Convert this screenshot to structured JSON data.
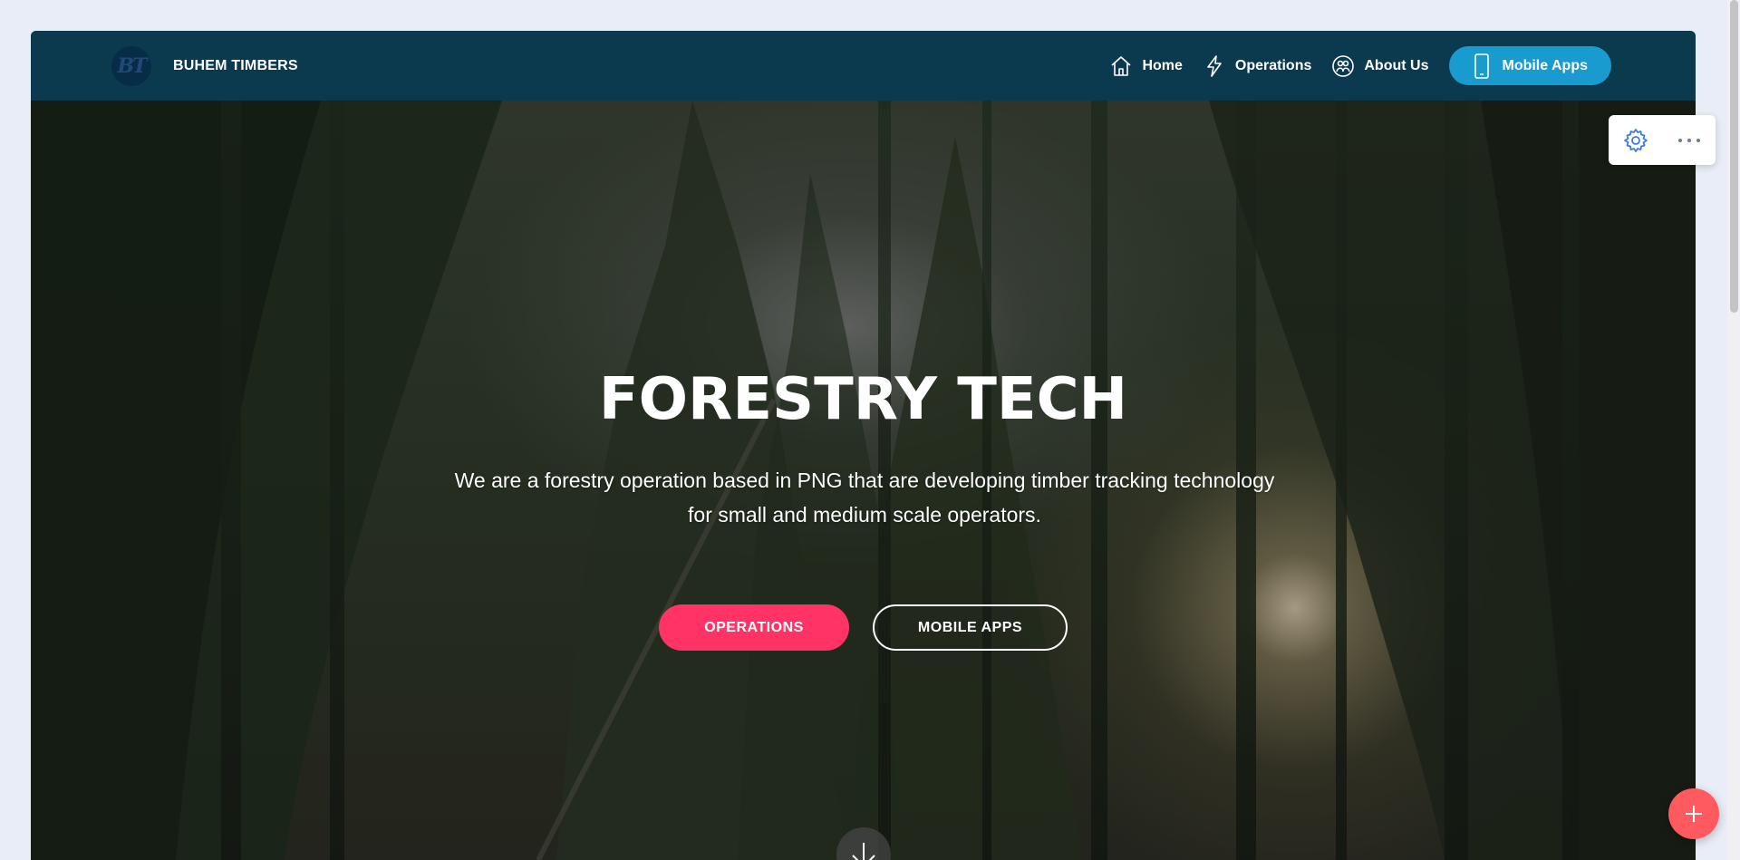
{
  "navbar": {
    "logo_text": "BT",
    "brand": "BUHEM TIMBERS",
    "links": [
      {
        "label": "Home",
        "icon": "home-icon"
      },
      {
        "label": "Operations",
        "icon": "lightning-icon"
      },
      {
        "label": "About Us",
        "icon": "people-circle-icon"
      }
    ],
    "cta": {
      "label": "Mobile Apps",
      "icon": "mobile-phone-icon"
    }
  },
  "hero": {
    "title": "FORESTRY TECH",
    "text": "We are a forestry operation based in PNG that are developing timber tracking technology for small and medium scale operators.",
    "buttons": {
      "primary": "OPERATIONS",
      "secondary": "MOBILE APPS"
    },
    "scroll_icon": "arrow-down-icon",
    "background": "forest-canopy-photo"
  },
  "editor_tools": {
    "settings_icon": "gear-icon",
    "more_icon": "more-dots-icon",
    "add_icon": "plus-icon"
  },
  "colors": {
    "navbar_bg": "#0b3a4f",
    "cta_bg": "#1a9bd0",
    "primary_button": "#ff3366",
    "fab": "#ff5a5f",
    "page_bg": "#e8edf7"
  }
}
